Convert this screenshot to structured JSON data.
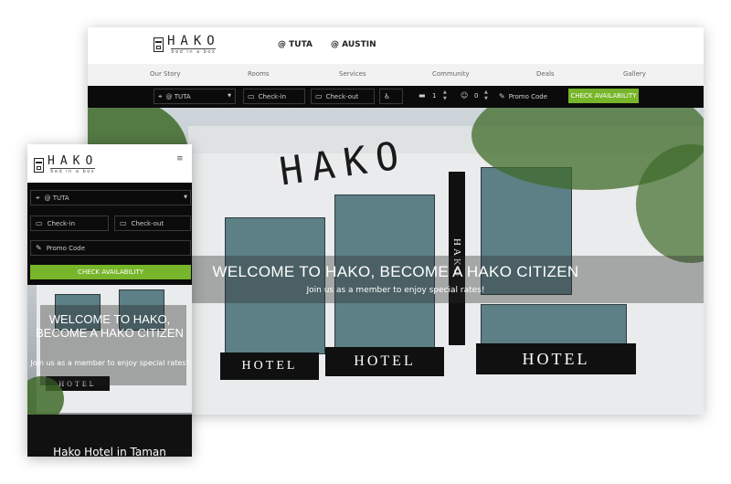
{
  "brand": {
    "name": "HAKO",
    "tagline": "bed in a box"
  },
  "desktop": {
    "locations": [
      "@ TUTA",
      "@ AUSTIN"
    ],
    "nav": [
      "Our Story",
      "Rooms",
      "Services",
      "Community",
      "Deals",
      "Gallery"
    ],
    "booking": {
      "location": "@ TUTA",
      "checkin_placeholder": "Check-in",
      "checkout_placeholder": "Check-out",
      "rooms": "1",
      "guests": "0",
      "promo_placeholder": "Promo Code",
      "submit": "CHECK AVAILABILITY"
    },
    "hero": {
      "title": "WELCOME TO HAKO, BECOME A HAKO CITIZEN",
      "subtitle": "Join us as a member to enjoy special rates!",
      "sign_text": "HAKO",
      "hotel_label": "HOTEL"
    }
  },
  "mobile": {
    "menu_icon": "≡",
    "booking": {
      "location": "@ TUTA",
      "checkin_placeholder": "Check-in",
      "checkout_placeholder": "Check-out",
      "promo_placeholder": "Promo Code",
      "submit": "CHECK AVAILABILITY"
    },
    "hero": {
      "title": "WELCOME TO HAKO, BECOME A HAKO CITIZEN",
      "subtitle": "Join us as a member to enjoy special rates!"
    },
    "footer_title": "Hako Hotel in Taman"
  },
  "colors": {
    "accent": "#77b52a",
    "bar": "#0b0b0b"
  }
}
